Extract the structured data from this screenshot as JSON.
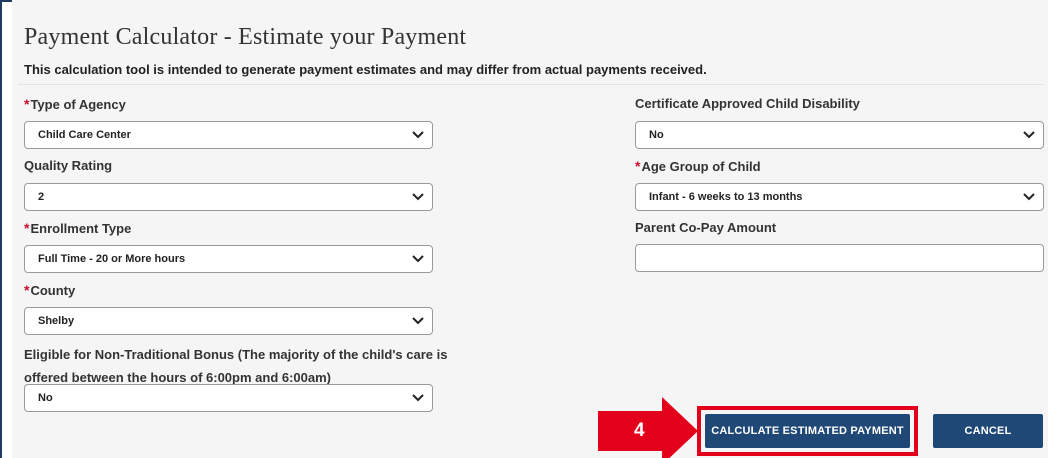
{
  "page": {
    "title": "Payment Calculator - Estimate your Payment",
    "subtitle": "This calculation tool is intended to generate payment estimates and may differ from actual payments received."
  },
  "required_mark": "*",
  "left_fields": {
    "agency_type": {
      "label": "Type of Agency",
      "required": true,
      "value": "Child Care Center"
    },
    "quality_rating": {
      "label": "Quality Rating",
      "required": false,
      "value": "2"
    },
    "enrollment_type": {
      "label": "Enrollment Type",
      "required": true,
      "value": "Full Time - 20 or More hours"
    },
    "county": {
      "label": "County",
      "required": true,
      "value": "Shelby"
    },
    "non_traditional": {
      "label_line1": "Eligible for Non-Traditional Bonus (The majority of the child's care is",
      "label_line2": "offered between the hours of 6:00pm and 6:00am)",
      "value": "No"
    }
  },
  "right_fields": {
    "disability": {
      "label": "Certificate Approved Child Disability",
      "required": false,
      "value": "No"
    },
    "age_group": {
      "label": "Age Group of Child",
      "required": true,
      "value": "Infant - 6 weeks to 13 months"
    },
    "copay": {
      "label": "Parent Co-Pay Amount",
      "value": ""
    }
  },
  "buttons": {
    "calculate": "CALCULATE ESTIMATED PAYMENT",
    "cancel": "CANCEL"
  },
  "annotation": {
    "step_number": "4",
    "color": "#e2001a"
  },
  "colors": {
    "button_bg": "#1f4876",
    "required": "#c8102e",
    "frame": "#1f3a63"
  }
}
